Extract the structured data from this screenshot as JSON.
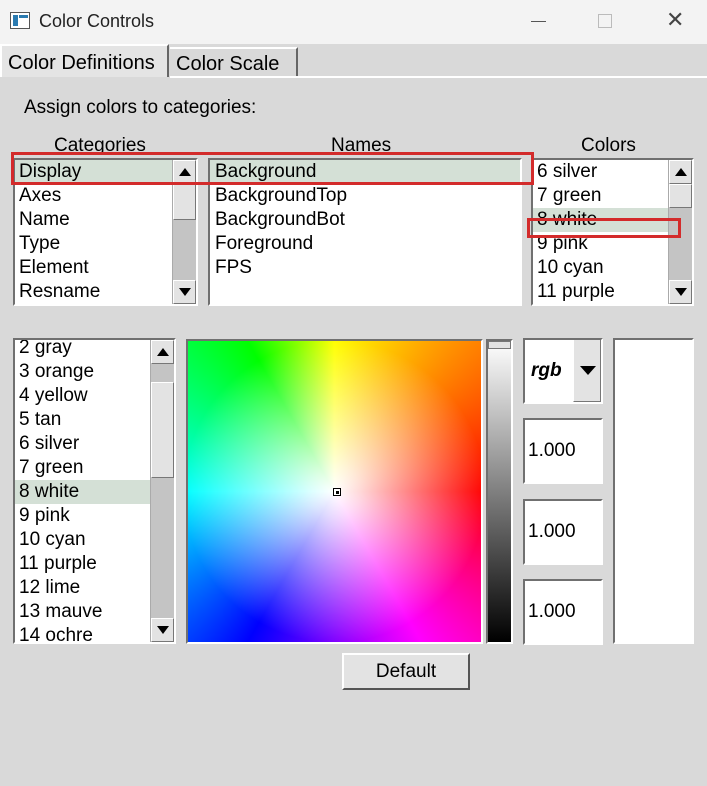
{
  "window": {
    "title": "Color Controls"
  },
  "tabs": [
    {
      "label": "Color Definitions",
      "active": true
    },
    {
      "label": "Color Scale",
      "active": false
    }
  ],
  "assign_label": "Assign colors to categories:",
  "columns": {
    "categories": "Categories",
    "names": "Names",
    "colors": "Colors"
  },
  "categories_list": {
    "items": [
      "Display",
      "Axes",
      "Name",
      "Type",
      "Element",
      "Resname"
    ],
    "selected": "Display"
  },
  "names_list": {
    "items": [
      "Background",
      "BackgroundTop",
      "BackgroundBot",
      "Foreground",
      "FPS"
    ],
    "selected": "Background"
  },
  "colors_list": {
    "items": [
      "6 silver",
      "7 green",
      "8 white",
      "9 pink",
      "10 cyan",
      "11 purple"
    ],
    "selected": "8 white"
  },
  "palette_list": {
    "items": [
      "2 gray",
      "3 orange",
      "4 yellow",
      "5 tan",
      "6 silver",
      "7 green",
      "8 white",
      "9 pink",
      "10 cyan",
      "11 purple",
      "12 lime",
      "13 mauve",
      "14 ochre"
    ],
    "selected": "8 white"
  },
  "color_mode": {
    "value": "rgb"
  },
  "components": {
    "r": "1.000",
    "g": "1.000",
    "b": "1.000"
  },
  "preview_color": "#ffffff",
  "default_button": "Default",
  "colors": {
    "selection": "#d4e0d6",
    "annotation_box": "#d32b2b",
    "background": "#d9d9d9"
  }
}
